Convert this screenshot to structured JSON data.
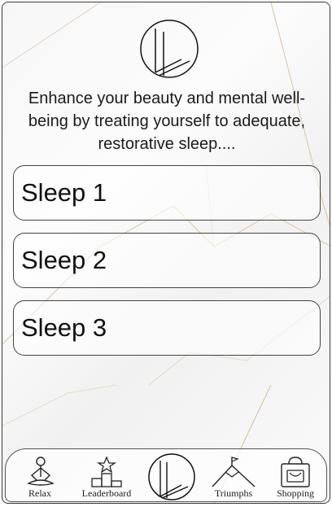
{
  "tagline": "Enhance your beauty and mental well-being by treating yourself to adequate, restorative sleep....",
  "sleep_options": [
    {
      "label": "Sleep 1"
    },
    {
      "label": "Sleep 2"
    },
    {
      "label": "Sleep 3"
    }
  ],
  "tabs": [
    {
      "label": "Relax",
      "icon": "meditation-icon"
    },
    {
      "label": "Leaderboard",
      "icon": "podium-star-icon"
    },
    {
      "label": "",
      "icon": "brand-logo-icon"
    },
    {
      "label": "Triumphs",
      "icon": "mountain-flag-icon"
    },
    {
      "label": "Shopping",
      "icon": "shopping-bag-icon"
    }
  ],
  "colors": {
    "accent_vein": "#c9a36a",
    "line": "#333333"
  }
}
